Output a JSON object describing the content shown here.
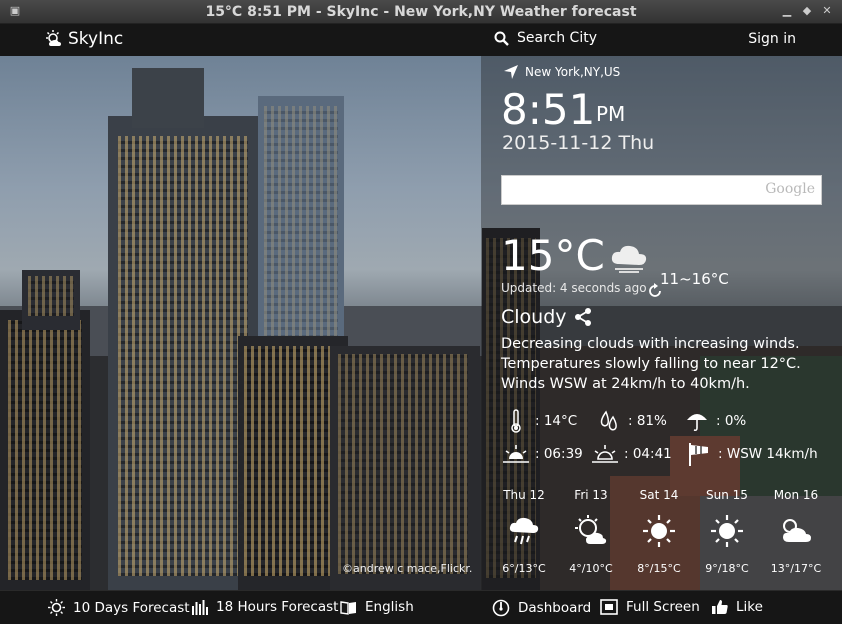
{
  "window": {
    "title": "15°C 8:51 PM - SkyInc - New York,NY Weather forecast"
  },
  "header": {
    "brand": "SkyInc",
    "search_label": "Search City",
    "signin_label": "Sign in"
  },
  "location": "New York,NY,US",
  "clock": {
    "time": "8:51",
    "ampm": "PM",
    "date": "2015-11-12 Thu"
  },
  "google_search": {
    "brand_text": "Google",
    "value": ""
  },
  "current": {
    "temperature": "15°C",
    "updated": "Updated: 4 seconds ago",
    "range": "11~16°C",
    "condition": "Cloudy",
    "description_lines": [
      "Decreasing clouds with increasing winds.",
      "Temperatures slowly falling to near 12°C.",
      "Winds WSW at 24km/h to 40km/h."
    ]
  },
  "stats": {
    "feels_temp": ": 14°C",
    "humidity": ": 81%",
    "precip": ": 0%",
    "sunrise": ": 06:39",
    "sunset": ": 04:41",
    "wind": ": WSW 14km/h"
  },
  "forecast": [
    {
      "day": "Thu 12",
      "range": "6°/13°C",
      "icon": "rain-cloud-icon"
    },
    {
      "day": "Fri 13",
      "range": "4°/10°C",
      "icon": "partly-sunny-icon"
    },
    {
      "day": "Sat 14",
      "range": "8°/15°C",
      "icon": "sun-icon"
    },
    {
      "day": "Sun 15",
      "range": "9°/18°C",
      "icon": "sun-icon"
    },
    {
      "day": "Mon 16",
      "range": "13°/17°C",
      "icon": "cloudy-icon"
    }
  ],
  "photo_credit": "©andrew c mace,Flickr.",
  "footer": {
    "ten_day": "10 Days Forecast",
    "eighteen_hour": "18 Hours Forecast",
    "language": "English",
    "dashboard": "Dashboard",
    "fullscreen": "Full Screen",
    "like": "Like"
  }
}
